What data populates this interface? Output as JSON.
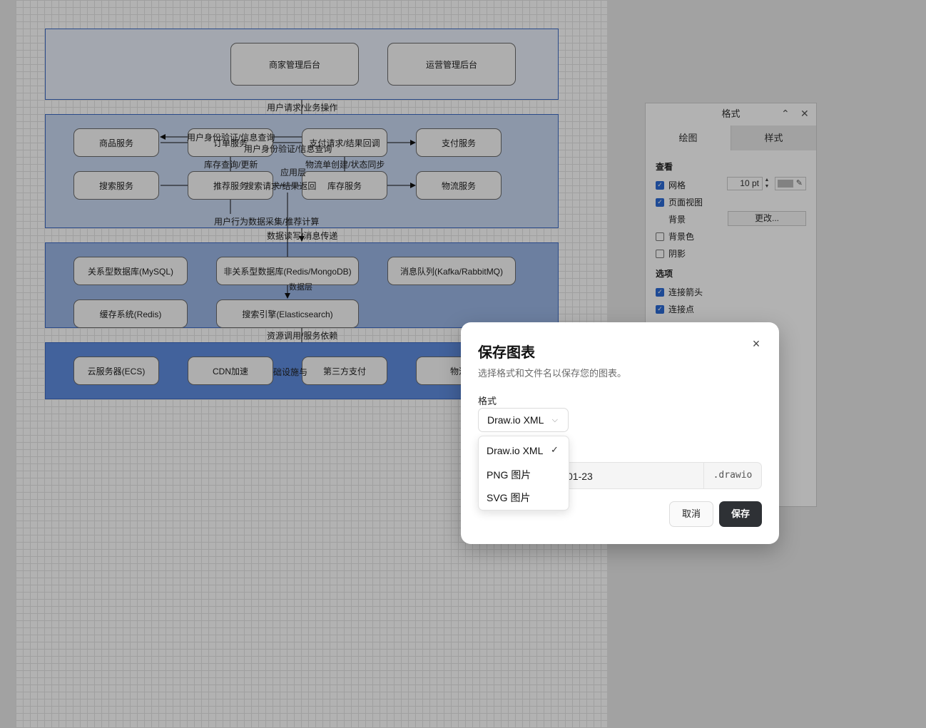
{
  "diagram": {
    "top_layer_boxes": [
      "商家管理后台",
      "运营管理后台"
    ],
    "app_layer_boxes": [
      "商品服务",
      "订单服务",
      "支付请求/结果回调",
      "支付服务",
      "搜索服务",
      "推荐服务",
      "库存服务",
      "物流服务"
    ],
    "data_layer_boxes": [
      "关系型数据库(MySQL)",
      "非关系型数据库(Redis/MongoDB)",
      "消息队列(Kafka/RabbitMQ)",
      "缓存系统(Redis)",
      "搜索引擎(Elasticsearch)"
    ],
    "infra_layer_boxes": [
      "云服务器(ECS)",
      "CDN加速",
      "第三方支付",
      "物流"
    ],
    "labels": {
      "user_request": "用户请求/业务操作",
      "auth_query_1": "用户身份验证/信息查询",
      "auth_query_2": "用户身份验证/信息查询",
      "inventory": "库存查询/更新",
      "logistics_sync": "物流单创建/状态同步",
      "app_layer": "应用层",
      "search_return": "搜索请求/结果返回",
      "behavior": "用户行为数据采集/推荐计算",
      "data_rw": "数据读写/消息传递",
      "data_layer": "数据层",
      "resource": "资源调用/服务依赖",
      "infra_fragment": "础设施与"
    }
  },
  "format_panel": {
    "title": "格式",
    "tabs": [
      "绘图",
      "样式"
    ],
    "view_section": "查看",
    "grid_label": "网格",
    "grid_size": "10 pt",
    "page_view_label": "页面视图",
    "background_label": "背景",
    "change_button": "更改...",
    "bg_color_label": "背景色",
    "shadow_label": "阴影",
    "options_section": "选项",
    "connect_arrows_label": "连接箭头",
    "connect_points_label": "连接点"
  },
  "dialog": {
    "title": "保存图表",
    "description": "选择格式和文件名以保存您的图表。",
    "format_label": "格式",
    "selected_format": "Draw.io XML",
    "options": [
      "Draw.io XML",
      "PNG 图片",
      "SVG 图片"
    ],
    "filename_value": "01-23",
    "extension": ".drawio",
    "cancel": "取消",
    "save": "保存"
  }
}
